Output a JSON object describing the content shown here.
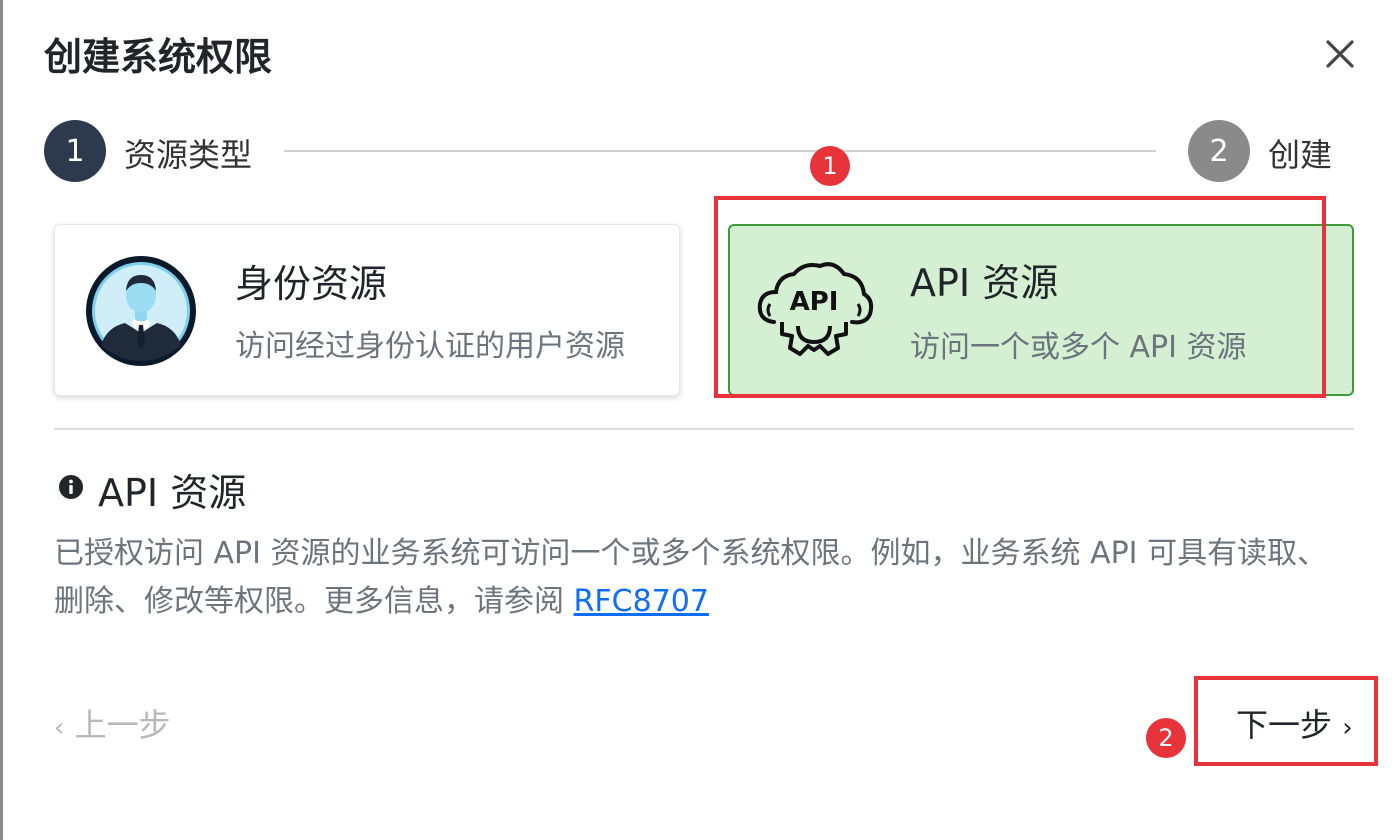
{
  "dialog": {
    "title": "创建系统权限",
    "close_icon": "close-icon"
  },
  "stepper": {
    "steps": [
      {
        "number": "1",
        "label": "资源类型",
        "active": true
      },
      {
        "number": "2",
        "label": "创建",
        "active": false
      }
    ]
  },
  "resource_types": [
    {
      "title": "身份资源",
      "description": "访问经过身份认证的用户资源",
      "icon": "user-avatar-icon",
      "selected": false
    },
    {
      "title": "API 资源",
      "description": "访问一个或多个 API 资源",
      "icon": "api-cloud-gear-icon",
      "selected": true
    }
  ],
  "info": {
    "icon": "info-icon",
    "title": "API 资源",
    "text": "已授权访问 API 资源的业务系统可访问一个或多个系统权限。例如，业务系统 API 可具有读取、删除、修改等权限。更多信息，请参阅 ",
    "link": "RFC8707"
  },
  "navigation": {
    "prev_chevron": "‹",
    "prev_label": "上一步",
    "next_label": "下一步",
    "next_chevron": "›"
  },
  "annotations": {
    "markers": [
      "1",
      "2"
    ],
    "color": "#e8333a"
  },
  "colors": {
    "step_active": "#2d3a4e",
    "step_inactive": "#8a8a8a",
    "selected_card_bg": "#d4efd1",
    "selected_card_border": "#3f9a3c",
    "link": "#0d6efd"
  }
}
